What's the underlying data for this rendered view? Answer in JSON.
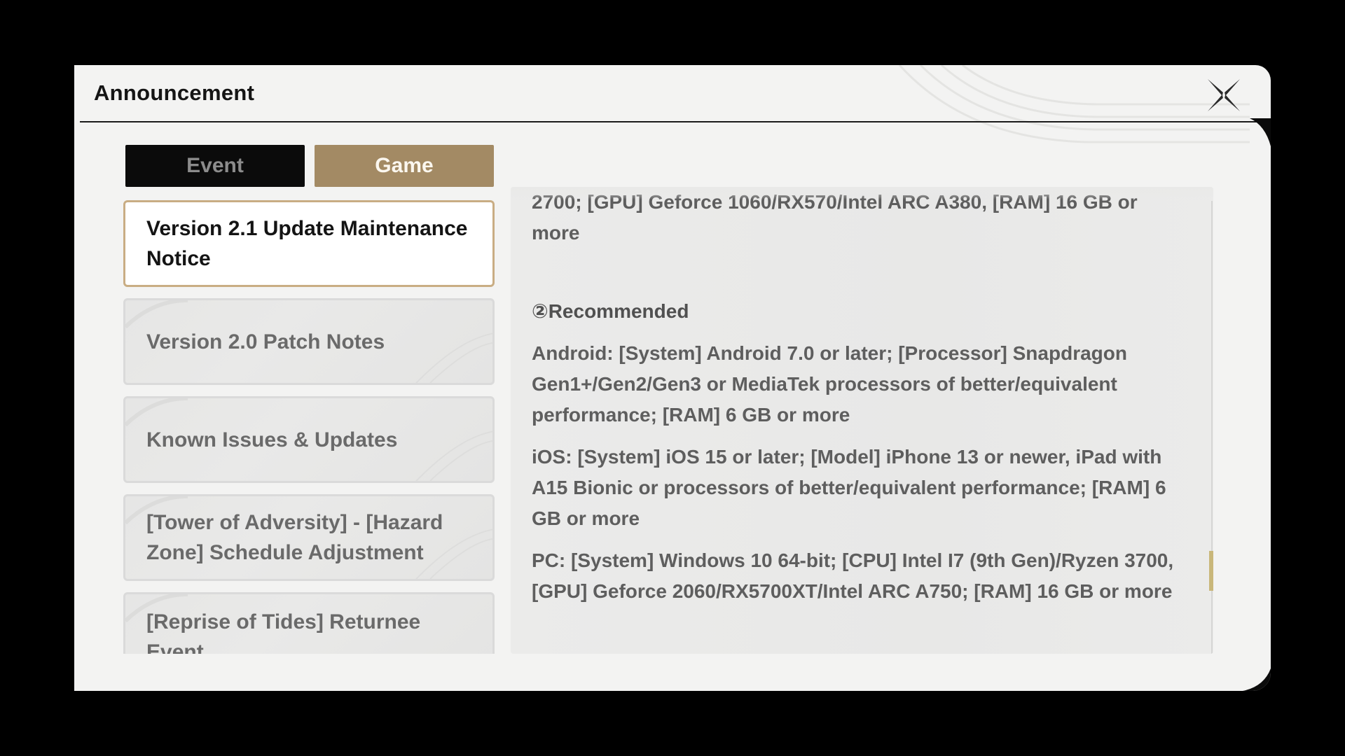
{
  "window": {
    "title": "Announcement",
    "close_icon": "close-x-icon"
  },
  "tabs": [
    {
      "label": "Event",
      "selected": false
    },
    {
      "label": "Game",
      "selected": true
    }
  ],
  "announcements": [
    {
      "label": "Version 2.1 Update Maintenance Notice",
      "selected": true
    },
    {
      "label": "Version 2.0 Patch Notes",
      "selected": false
    },
    {
      "label": "Known Issues & Updates",
      "selected": false
    },
    {
      "label": "[Tower of Adversity] - [Hazard Zone] Schedule Adjustment",
      "selected": false
    },
    {
      "label": "[Reprise of Tides] Returnee Event",
      "selected": false
    }
  ],
  "content": {
    "paragraphs": [
      "2700; [GPU] Geforce 1060/RX570/Intel ARC A380, [RAM] 16 GB or more",
      "②Recommended",
      "Android: [System] Android 7.0 or later; [Processor] Snapdragon Gen1+/Gen2/Gen3 or MediaTek processors of better/equivalent performance; [RAM] 6 GB or more",
      "iOS: [System] iOS 15 or later; [Model] iPhone 13 or newer, iPad with A15 Bionic or processors of better/equivalent performance; [RAM] 6 GB or more",
      "PC: [System] Windows 10 64-bit; [CPU] Intel I7 (9th Gen)/Ryzen 3700, [GPU] Geforce 2060/RX5700XT/Intel ARC A750; [RAM] 16 GB or more"
    ]
  },
  "colors": {
    "accent_gold": "#a38a64",
    "selected_border": "#c9ad84",
    "scroll_thumb": "#c9b77a",
    "panel_bg": "#f3f3f2"
  }
}
